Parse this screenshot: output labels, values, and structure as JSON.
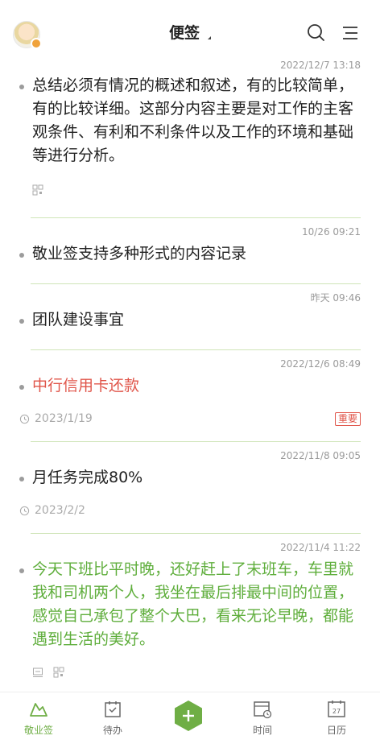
{
  "header": {
    "title": "便签",
    "avatar_icon": "avatar-icon",
    "search_icon": "search-icon",
    "menu_icon": "menu-icon"
  },
  "notes": [
    {
      "time": "2022/12/7 13:18",
      "text": "总结必须有情况的概述和叙述，有的比较简单，有的比较详细。这部分内容主要是对工作的主客观条件、有利和不利条件以及工作的环境和基础等进行分析。",
      "color": "default"
    },
    {
      "time": "10/26 09:21",
      "text": "敬业签支持多种形式的内容记录",
      "color": "default"
    },
    {
      "time": "昨天 09:46",
      "text": "团队建设事宜",
      "color": "default"
    },
    {
      "time": "2022/12/6 08:49",
      "text": "中行信用卡还款",
      "color": "#e0554a",
      "reminder": "2023/1/19",
      "tag": "重要"
    },
    {
      "time": "2022/11/8 09:05",
      "text": "月任务完成80%",
      "color": "default",
      "reminder": "2023/2/2"
    },
    {
      "time": "2022/11/4 11:22",
      "text": "今天下班比平时晚，还好赶上了末班车，车里就我和司机两个人，我坐在最后排最中间的位置，感觉自己承包了整个大巴，看来无论早晚，都能遇到生活的美好。",
      "color": "#5fae3c"
    }
  ],
  "tabbar": {
    "tabs": [
      {
        "label": "敬业签",
        "icon": "notes-icon",
        "active": true
      },
      {
        "label": "待办",
        "icon": "todo-icon",
        "active": false
      },
      {
        "label": "时间",
        "icon": "time-icon",
        "active": false
      },
      {
        "label": "日历",
        "icon": "calendar-icon",
        "active": false
      }
    ],
    "fab_icon": "plus-icon",
    "calendar_day": "27"
  },
  "colors": {
    "accent": "#6fae45",
    "important": "#e0554a",
    "divider": "#cfe5b8"
  }
}
